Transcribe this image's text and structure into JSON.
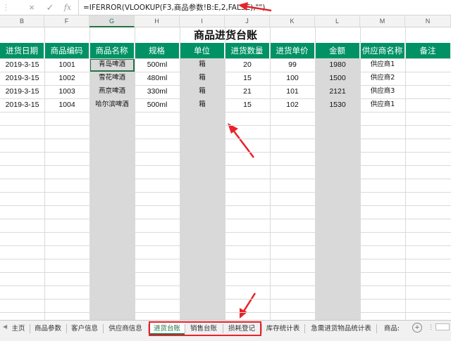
{
  "formula_bar": {
    "cancel_icon": "×",
    "enter_icon": "✓",
    "fx_label": "fx",
    "formula": "=IFERROR(VLOOKUP(F3,商品参数!B:E,2,FALSE),\"\")"
  },
  "columns": [
    "B",
    "F",
    "G",
    "H",
    "I",
    "J",
    "K",
    "L",
    "M",
    "N"
  ],
  "sheet": {
    "title": "商品进货台账",
    "headers": [
      "进货日期",
      "商品编码",
      "商品名称",
      "规格",
      "单位",
      "进货数量",
      "进货单价",
      "金额",
      "供应商名称",
      "备注"
    ],
    "rows": [
      [
        "2019-3-15",
        "1001",
        "青岛啤酒",
        "500ml",
        "箱",
        "20",
        "99",
        "1980",
        "供应商1",
        ""
      ],
      [
        "2019-3-15",
        "1002",
        "雪花啤酒",
        "480ml",
        "箱",
        "15",
        "100",
        "1500",
        "供应商2",
        ""
      ],
      [
        "2019-3-15",
        "1003",
        "燕京啤酒",
        "330ml",
        "箱",
        "21",
        "101",
        "2121",
        "供应商3",
        ""
      ],
      [
        "2019-3-15",
        "1004",
        "哈尔滨啤酒",
        "500ml",
        "箱",
        "15",
        "102",
        "1530",
        "供应商1",
        ""
      ]
    ]
  },
  "tabs": [
    "主页",
    "商品参数",
    "客户信息",
    "供应商信息",
    "进货台账",
    "销售台账",
    "损耗登记",
    "库存统计表",
    "急需进货物品统计表",
    "商品:"
  ],
  "active_tab": "进货台账",
  "add_sheet_label": "+",
  "colors": {
    "header_green": "#009264",
    "highlight_gray": "#d9d9d9",
    "annotation_red": "#e8222a",
    "active_tab_green": "#1e7145"
  }
}
